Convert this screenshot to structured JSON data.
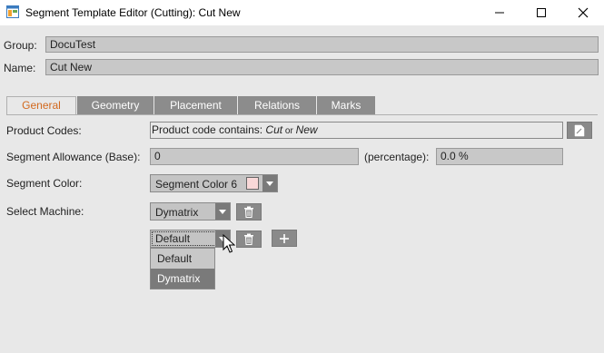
{
  "window": {
    "title": "Segment Template Editor (Cutting): Cut New"
  },
  "form": {
    "group_label": "Group:",
    "group_value": "DocuTest",
    "name_label": "Name:",
    "name_value": "Cut New"
  },
  "tabs": [
    {
      "label": "General",
      "active": true
    },
    {
      "label": "Geometry",
      "active": false
    },
    {
      "label": "Placement",
      "active": false
    },
    {
      "label": "Relations",
      "active": false
    },
    {
      "label": "Marks",
      "active": false
    }
  ],
  "general": {
    "product_codes_label": "Product Codes:",
    "product_codes_prefix": "Product code contains: ",
    "product_codes_term1": "Cut",
    "product_codes_or": " or ",
    "product_codes_term2": "New",
    "allowance_label": "Segment Allowance (Base):",
    "allowance_value": "0",
    "percentage_label": "(percentage):",
    "percentage_value": "0.0 %",
    "color_label": "Segment Color:",
    "color_value": "Segment Color 6",
    "color_swatch": "#f8d8d8",
    "machine_label": "Select Machine:",
    "machine_value": "Dymatrix",
    "second_select_value": "Default"
  },
  "dropdown": {
    "options": [
      "Default",
      "Dymatrix"
    ],
    "highlighted": "Dymatrix"
  },
  "colors": {
    "active_tab_text": "#d2691e",
    "tab_bg": "#8c8c8c"
  }
}
